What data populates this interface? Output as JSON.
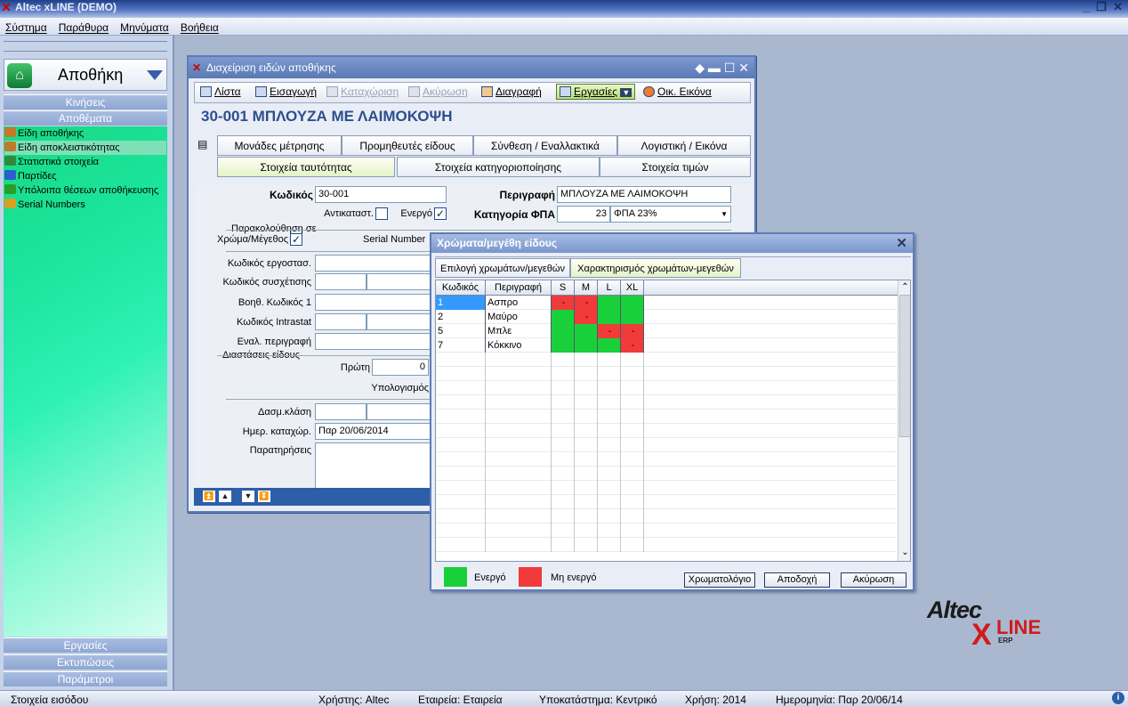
{
  "app": {
    "title": "Altec xLINE (DEMO)"
  },
  "menu": [
    "Σύστημα",
    "Παράθυρα",
    "Μηνύματα",
    "Βοήθεια"
  ],
  "sidebar": {
    "module": "Αποθήκη",
    "sections_top": [
      "Κινήσεις",
      "Αποθέματα"
    ],
    "items": [
      {
        "label": "Είδη αποθήκης",
        "color": "#c07a2a"
      },
      {
        "label": "Είδη αποκλειστικότητας",
        "color": "#c07a2a"
      },
      {
        "label": "Στατιστικά στοιχεία",
        "color": "#2c8c3c"
      },
      {
        "label": "Παρτίδες",
        "color": "#2a5fd0"
      },
      {
        "label": "Υπόλοιπα θέσεων αποθήκευσης",
        "color": "#28a028"
      },
      {
        "label": "Serial Numbers",
        "color": "#d8a020"
      }
    ],
    "sections_bottom": [
      "Εργασίες",
      "Εκτυπώσεις",
      "Παράμετροι"
    ]
  },
  "window": {
    "title": "Διαχείριση ειδών αποθήκης",
    "toolbar": {
      "list": "Λίστα",
      "insert": "Εισαγωγή",
      "save": "Καταχώριση",
      "cancel": "Ακύρωση",
      "delete": "Διαγραφή",
      "tasks": "Εργασίες",
      "fin": "Οικ. Εικόνα"
    },
    "item_title": "30-001 ΜΠΛΟΥΖΑ ΜΕ ΛΑΙΜΟΚΟΨΗ",
    "tabs_row1": [
      "Μονάδες μέτρησης",
      "Προμηθευτές είδους",
      "Σύνθεση / Εναλλακτικά",
      "Λογιστική / Εικόνα"
    ],
    "tabs_row2": [
      "Στοιχεία ταυτότητας",
      "Στοιχεία κατηγοριοποίησης",
      "Στοιχεία τιμών"
    ],
    "form": {
      "code_label": "Κωδικός",
      "code": "30-001",
      "desc_label": "Περιγραφή",
      "desc": "ΜΠΛΟΥΖΑ ΜΕ ΛΑΙΜΟΚΟΨΗ",
      "replace_label": "Αντικαταστ.",
      "active_label": "Ενεργό",
      "vat_label": "Κατηγορία ΦΠΑ",
      "vat_code": "23",
      "vat_desc": "ΦΠΑ 23%",
      "track_label": "Παρακολούθηση σε",
      "colorsize_label": "Χρώμα/Μέγεθος",
      "serial_label": "Serial Number",
      "factory_code": "Κωδικός εργοστασ.",
      "relation_code": "Κωδικός συσχέτισης",
      "aux_code": "Βοηθ. Κωδικός 1",
      "intrastat": "Κωδικός Intrastat",
      "alt_desc": "Εναλ. περιγραφή",
      "dims": "Διαστάσεις είδους",
      "first": "Πρώτη",
      "first_val": "0",
      "calc": "Υπολογισμός",
      "customs": "Δασμ.κλάση",
      "reg_date_label": "Ημερ. καταχώρ.",
      "reg_date": "Παρ 20/06/2014",
      "notes": "Παρατηρήσεις"
    }
  },
  "dialog": {
    "title": "Χρώματα/μεγέθη είδους",
    "tabs": [
      "Επιλογή χρωμάτων/μεγεθών",
      "Χαρακτηρισμός χρωμάτων-μεγεθών"
    ],
    "columns": [
      "Κωδικός",
      "Περιγραφή",
      "S",
      "M",
      "L",
      "XL"
    ],
    "rows": [
      {
        "code": "1",
        "desc": "Ασπρο",
        "cells": [
          "off",
          "off",
          "on",
          "on"
        ]
      },
      {
        "code": "2",
        "desc": "Μαύρο",
        "cells": [
          "on",
          "off",
          "on",
          "on"
        ]
      },
      {
        "code": "5",
        "desc": "Μπλε",
        "cells": [
          "on",
          "on",
          "off",
          "off"
        ]
      },
      {
        "code": "7",
        "desc": "Κόκκινο",
        "cells": [
          "on",
          "on",
          "on",
          "off"
        ]
      }
    ],
    "off_mark": "-",
    "legend_active": "Ενεργό",
    "legend_inactive": "Μη ενεργό",
    "btn_palette": "Χρωματολόγιο",
    "btn_ok": "Αποδοχή",
    "btn_cancel": "Ακύρωση",
    "colors": {
      "on": "#19d03a",
      "off": "#f13a3a"
    }
  },
  "status": {
    "entry": "Στοιχεία εισόδου",
    "user": "Χρήστης: Altec",
    "company": "Εταιρεία: Εταιρεία",
    "branch": "Υποκατάστημα: Κεντρικό",
    "year": "Χρήση: 2014",
    "date": "Ημερομηνία: Παρ 20/06/14"
  },
  "logo": {
    "top": "Altec",
    "x": "X",
    "line": "LINE",
    "erp": "ERP"
  }
}
